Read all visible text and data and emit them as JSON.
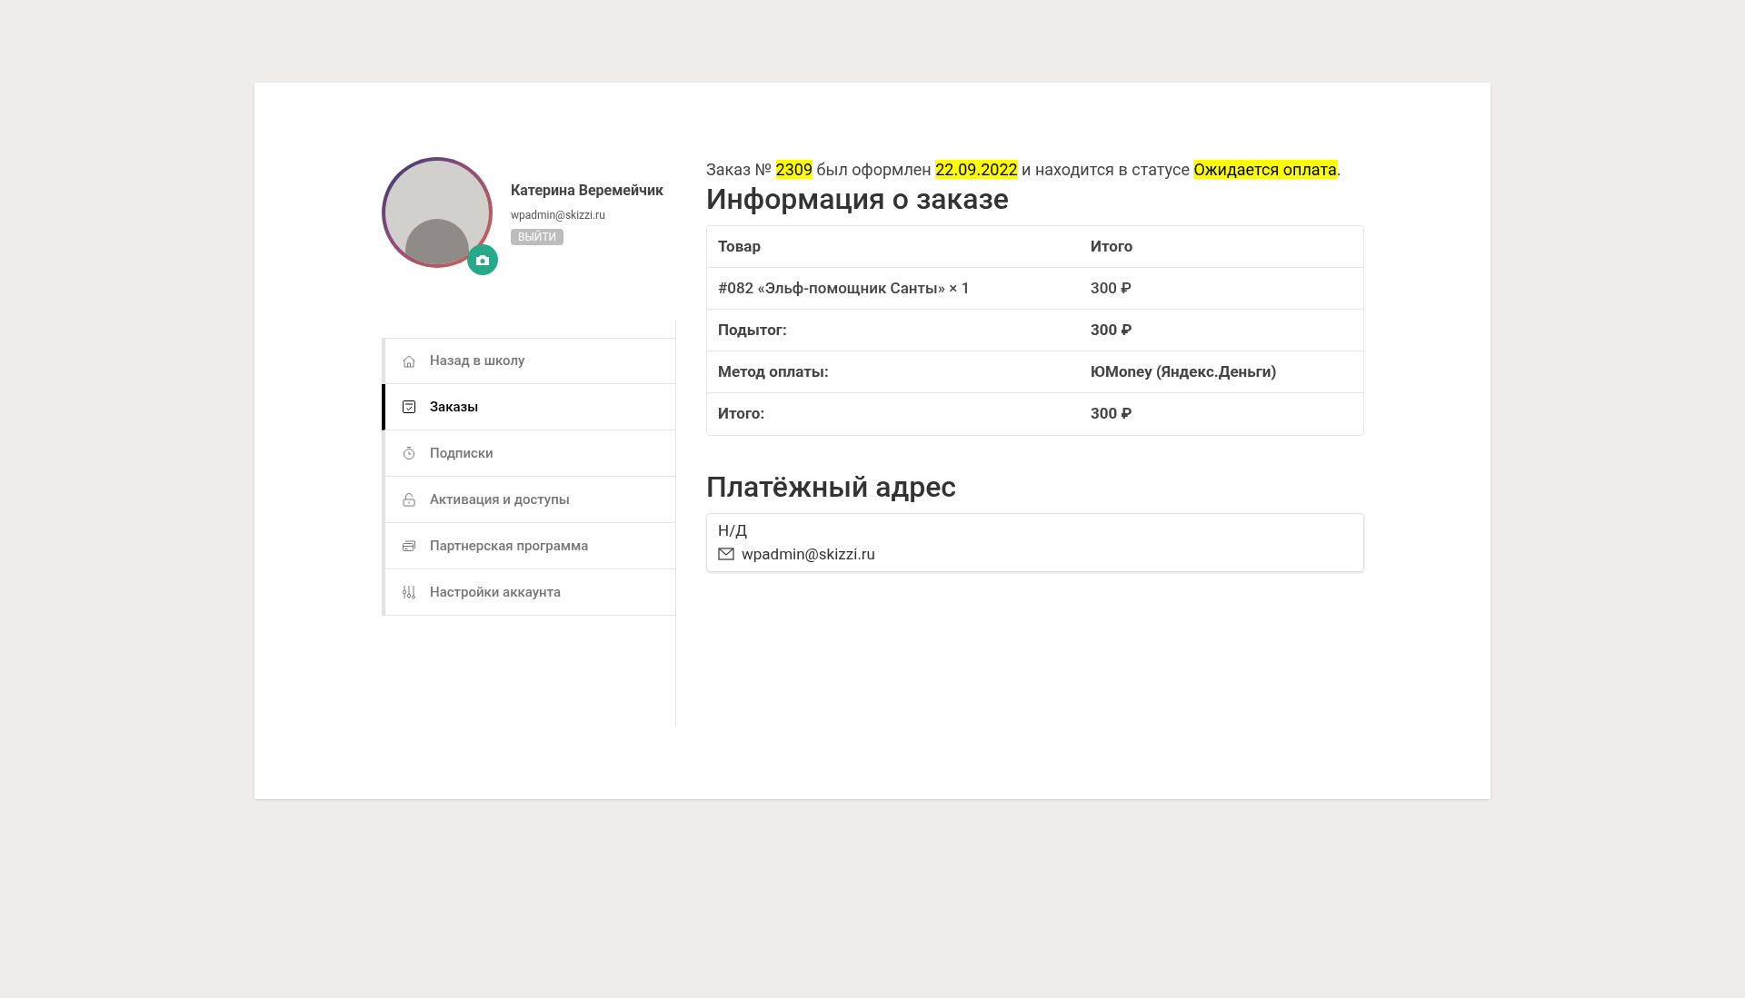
{
  "profile": {
    "name": "Катерина Веремейчик",
    "email": "wpadmin@skizzi.ru",
    "logout": "ВЫЙТИ"
  },
  "menu": [
    {
      "label": "Назад в школу",
      "selected": false
    },
    {
      "label": "Заказы",
      "selected": true
    },
    {
      "label": "Подписки",
      "selected": false
    },
    {
      "label": "Активация и доступы",
      "selected": false
    },
    {
      "label": "Партнерская программа",
      "selected": false
    },
    {
      "label": "Настройки аккаунта",
      "selected": false
    }
  ],
  "status_line": [
    {
      "text": "Заказ № ",
      "highlighted": false
    },
    {
      "text": "2309",
      "highlighted": true
    },
    {
      "text": " был оформлен ",
      "highlighted": false
    },
    {
      "text": "22.09.2022",
      "highlighted": true
    },
    {
      "text": " и находится в статусе ",
      "highlighted": false
    },
    {
      "text": "Ожидается оплата",
      "highlighted": true
    },
    {
      "text": ".",
      "highlighted": false
    }
  ],
  "order_title": "Информация о заказе",
  "table": {
    "columns": [
      "Товар",
      "Итого"
    ],
    "rows": [
      {
        "kind": "item",
        "label": "#082 «Эльф-помощник Санты» × 1",
        "value": "300 ₽"
      },
      {
        "kind": "total",
        "label": "Подытог:",
        "value": "300 ₽"
      },
      {
        "kind": "total",
        "label": "Метод оплаты:",
        "value": "ЮMoney (Яндекс.Деньги)"
      },
      {
        "kind": "total",
        "label": "Итого:",
        "value": "300 ₽"
      }
    ]
  },
  "billing": {
    "title": "Платёжный адрес",
    "address": "Н/Д",
    "email": "wpadmin@skizzi.ru"
  }
}
